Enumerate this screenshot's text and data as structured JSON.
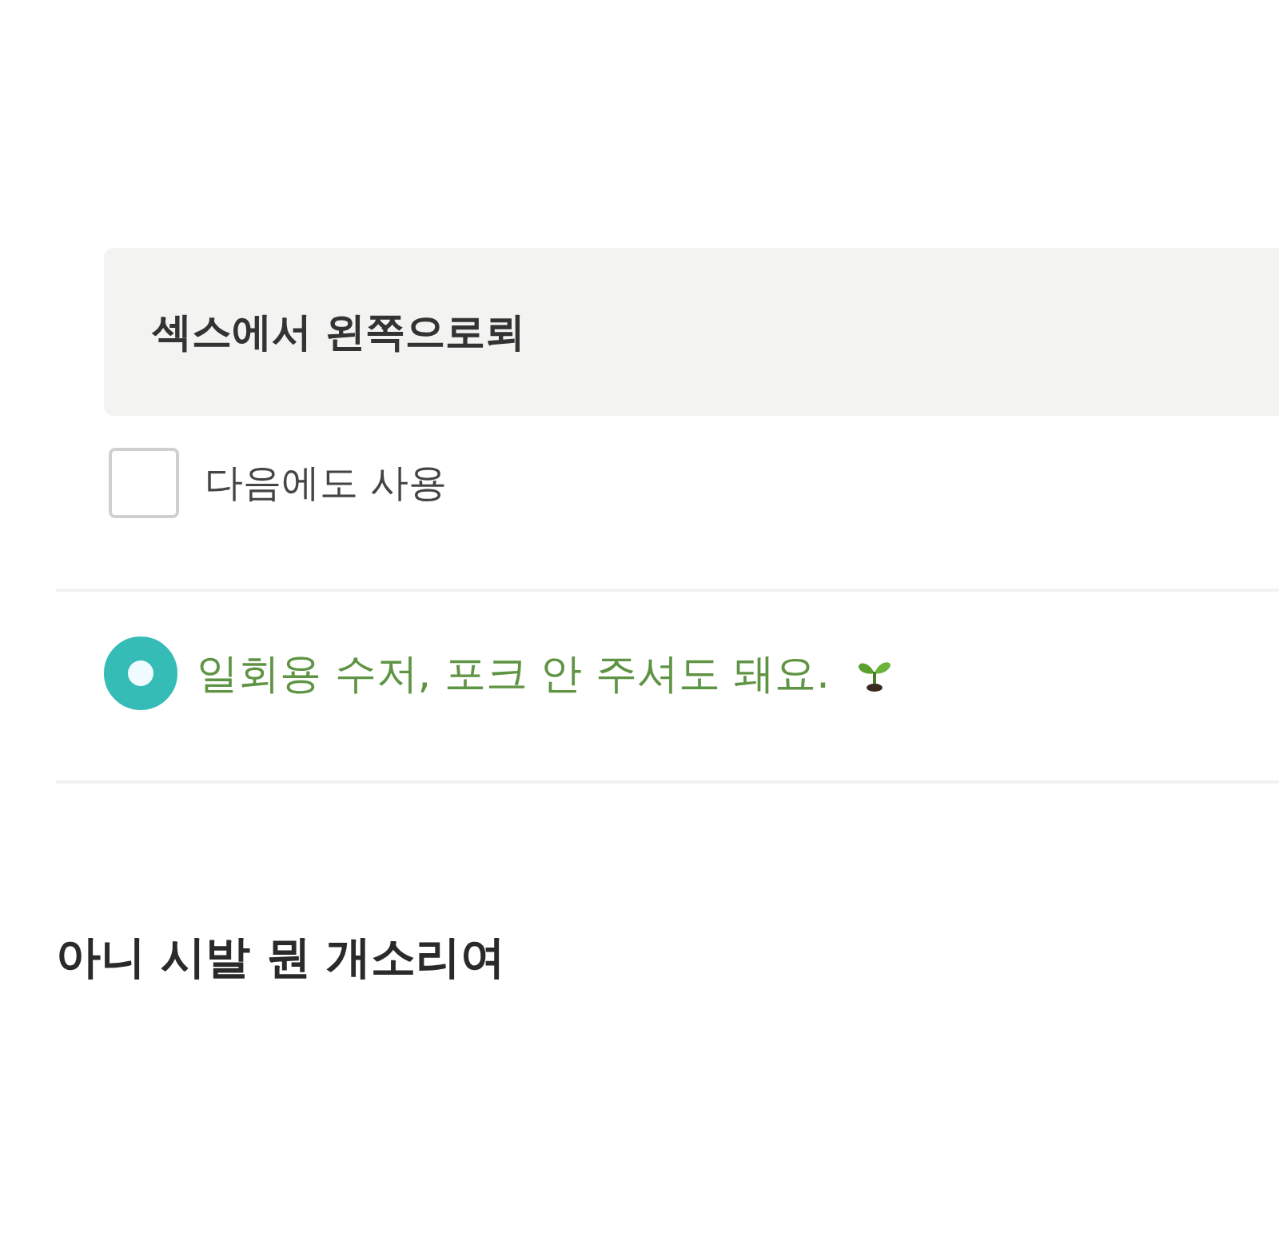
{
  "request_field": {
    "value": "섹스에서 왼쪽으로뢰"
  },
  "reuse_option": {
    "label": "다음에도 사용",
    "checked": false
  },
  "cutlery_option": {
    "label": "일회용 수저, 포크 안 주셔도 돼요.",
    "selected": true
  },
  "caption": "아니 시발 뭔 개소리여"
}
